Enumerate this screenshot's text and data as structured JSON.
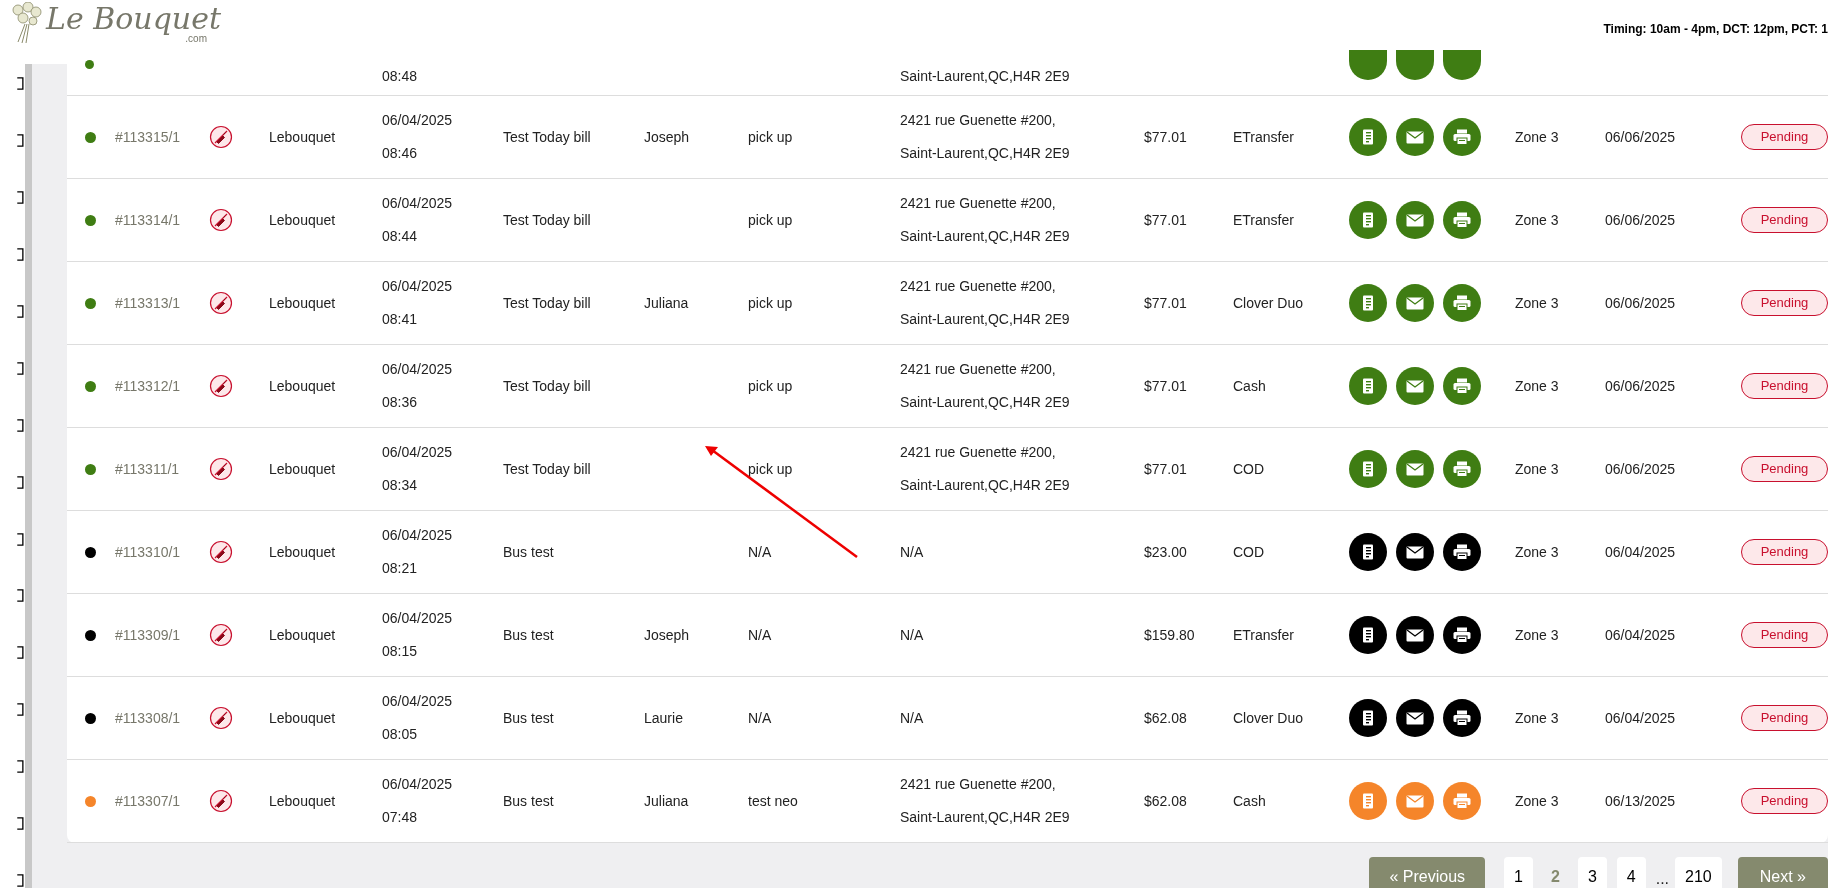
{
  "header": {
    "logo": {
      "name": "Le Bouquet",
      "suffix": ".com"
    },
    "timing": "Timing: 10am - 4pm, DCT: 12pm, PCT: 1"
  },
  "partial_row": {
    "time": "08:48",
    "address": "Saint-Laurent,QC,H4R 2E9",
    "color": "#3f7d13"
  },
  "rows": [
    {
      "id": "#113315/1",
      "color": "#3f7d13",
      "store": "Lebouquet",
      "date": "06/04/2025",
      "time": "08:46",
      "description": "Test Today bill",
      "customer": "Joseph",
      "method": "pick up",
      "address": [
        "2421 rue Guenette #200,",
        "Saint-Laurent,QC,H4R 2E9"
      ],
      "amount": "$77.01",
      "payment": "ETransfer",
      "zone": "Zone 3",
      "due": "06/06/2025",
      "status": "Pending"
    },
    {
      "id": "#113314/1",
      "color": "#3f7d13",
      "store": "Lebouquet",
      "date": "06/04/2025",
      "time": "08:44",
      "description": "Test Today bill",
      "customer": "",
      "method": "pick up",
      "address": [
        "2421 rue Guenette #200,",
        "Saint-Laurent,QC,H4R 2E9"
      ],
      "amount": "$77.01",
      "payment": "ETransfer",
      "zone": "Zone 3",
      "due": "06/06/2025",
      "status": "Pending"
    },
    {
      "id": "#113313/1",
      "color": "#3f7d13",
      "store": "Lebouquet",
      "date": "06/04/2025",
      "time": "08:41",
      "description": "Test Today bill",
      "customer": "Juliana",
      "method": "pick up",
      "address": [
        "2421 rue Guenette #200,",
        "Saint-Laurent,QC,H4R 2E9"
      ],
      "amount": "$77.01",
      "payment": "Clover Duo",
      "zone": "Zone 3",
      "due": "06/06/2025",
      "status": "Pending"
    },
    {
      "id": "#113312/1",
      "color": "#3f7d13",
      "store": "Lebouquet",
      "date": "06/04/2025",
      "time": "08:36",
      "description": "Test Today bill",
      "customer": "",
      "method": "pick up",
      "address": [
        "2421 rue Guenette #200,",
        "Saint-Laurent,QC,H4R 2E9"
      ],
      "amount": "$77.01",
      "payment": "Cash",
      "zone": "Zone 3",
      "due": "06/06/2025",
      "status": "Pending"
    },
    {
      "id": "#113311/1",
      "color": "#3f7d13",
      "store": "Lebouquet",
      "date": "06/04/2025",
      "time": "08:34",
      "description": "Test Today bill",
      "customer": "",
      "method": "pick up",
      "address": [
        "2421 rue Guenette #200,",
        "Saint-Laurent,QC,H4R 2E9"
      ],
      "amount": "$77.01",
      "payment": "COD",
      "zone": "Zone 3",
      "due": "06/06/2025",
      "status": "Pending"
    },
    {
      "id": "#113310/1",
      "color": "#000000",
      "store": "Lebouquet",
      "date": "06/04/2025",
      "time": "08:21",
      "description": "Bus test",
      "customer": "",
      "method": "N/A",
      "address": [
        "N/A"
      ],
      "amount": "$23.00",
      "payment": "COD",
      "zone": "Zone 3",
      "due": "06/04/2025",
      "status": "Pending"
    },
    {
      "id": "#113309/1",
      "color": "#000000",
      "store": "Lebouquet",
      "date": "06/04/2025",
      "time": "08:15",
      "description": "Bus test",
      "customer": "Joseph",
      "method": "N/A",
      "address": [
        "N/A"
      ],
      "amount": "$159.80",
      "payment": "ETransfer",
      "zone": "Zone 3",
      "due": "06/04/2025",
      "status": "Pending"
    },
    {
      "id": "#113308/1",
      "color": "#000000",
      "store": "Lebouquet",
      "date": "06/04/2025",
      "time": "08:05",
      "description": "Bus test",
      "customer": "Laurie",
      "method": "N/A",
      "address": [
        "N/A"
      ],
      "amount": "$62.08",
      "payment": "Clover Duo",
      "zone": "Zone 3",
      "due": "06/04/2025",
      "status": "Pending"
    },
    {
      "id": "#113307/1",
      "color": "#f5852a",
      "store": "Lebouquet",
      "date": "06/04/2025",
      "time": "07:48",
      "description": "Bus test",
      "customer": "Juliana",
      "method": "test neo",
      "address": [
        "2421 rue Guenette #200,",
        "Saint-Laurent,QC,H4R 2E9"
      ],
      "amount": "$62.08",
      "payment": "Cash",
      "zone": "Zone 3",
      "due": "06/13/2025",
      "status": "Pending"
    }
  ],
  "pagination": {
    "previous": "« Previous",
    "next": "Next »",
    "ellipsis": "...",
    "pages": [
      {
        "label": "1",
        "selected": false
      },
      {
        "label": "2",
        "selected": true
      },
      {
        "label": "3",
        "selected": false
      },
      {
        "label": "4",
        "selected": false
      },
      {
        "label": "210",
        "selected": false
      }
    ]
  }
}
